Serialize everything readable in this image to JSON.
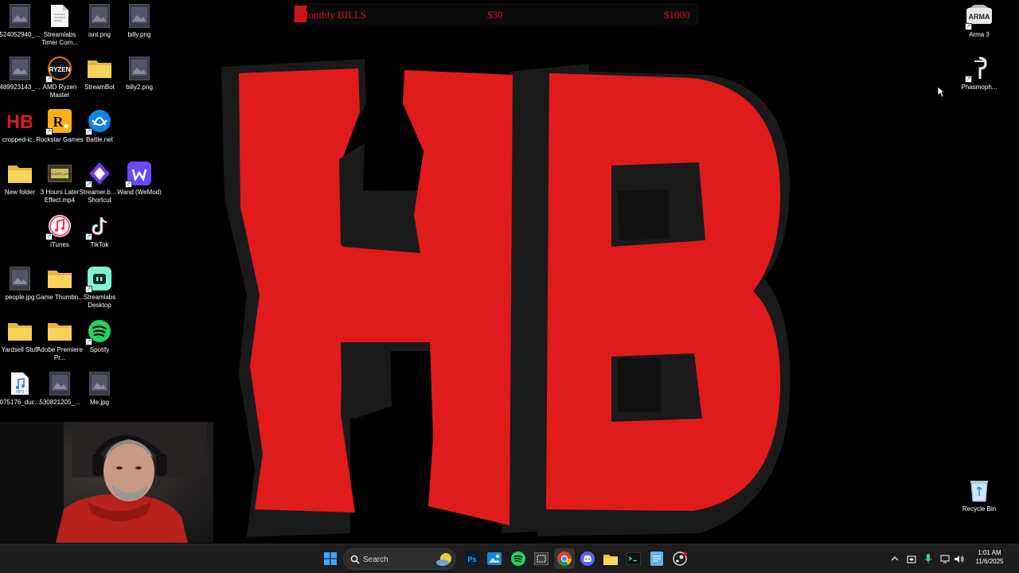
{
  "goal": {
    "title": "Monthly BILLS",
    "current": "$30",
    "target": "$1000",
    "progress_fraction": 0.03,
    "color": "#d0121b"
  },
  "brand": {
    "letters": "HB",
    "fill_color": "#e01b1b",
    "outline_color": "#1a1a1a"
  },
  "desktop_left": [
    {
      "label": "524052940_...",
      "icon": "image-icon"
    },
    {
      "label": "Streamlabs Timer Com...",
      "icon": "document-icon"
    },
    {
      "label": "isnt.png",
      "icon": "image-icon"
    },
    {
      "label": "billy.png",
      "icon": "image-icon"
    },
    {
      "label": "489923143_...",
      "icon": "image-icon"
    },
    {
      "label": "AMD Ryzen Master",
      "icon": "amd-ryzen-icon"
    },
    {
      "label": "StreamBot",
      "icon": "folder-icon"
    },
    {
      "label": "billy2.png",
      "icon": "image-icon"
    },
    {
      "label": "cropped-ic...",
      "icon": "hb-logo-icon"
    },
    {
      "label": "Rockstar Games ...",
      "icon": "rockstar-icon"
    },
    {
      "label": "Battle.net",
      "icon": "battlenet-icon"
    },
    {
      "label": "New folder",
      "icon": "folder-icon"
    },
    {
      "label": "3 Hours Later Effect.mp4",
      "icon": "video-icon"
    },
    {
      "label": "Streamer.b... - Shortcut",
      "icon": "streamerbot-icon"
    },
    {
      "label": "Wand (WeMod)",
      "icon": "wand-icon"
    },
    {
      "label": "iTunes",
      "icon": "itunes-icon"
    },
    {
      "label": "TikTok",
      "icon": "tiktok-icon"
    },
    {
      "label": "people.jpg",
      "icon": "image-icon"
    },
    {
      "label": "Game Thumbn...",
      "icon": "folder-icon"
    },
    {
      "label": "Streamlabs Desktop",
      "icon": "streamlabs-icon"
    },
    {
      "label": "Yardsell Stuff",
      "icon": "folder-icon"
    },
    {
      "label": "Adobe Premiere Pr...",
      "icon": "folder-icon"
    },
    {
      "label": "Spotify",
      "icon": "spotify-icon"
    },
    {
      "label": "075176_duc...",
      "icon": "audio-file-icon"
    },
    {
      "label": "530821205_...",
      "icon": "image-icon"
    },
    {
      "label": "Me.jpg",
      "icon": "image-icon"
    }
  ],
  "desktop_right": [
    {
      "label": "Arma 3",
      "icon": "arma3-icon"
    },
    {
      "label": "Phasmoph...",
      "icon": "phasmophobia-icon"
    },
    {
      "label": "Recycle Bin",
      "icon": "recycle-bin-icon"
    }
  ],
  "taskbar": {
    "search_placeholder": "Search",
    "apps": [
      "windows-start-icon",
      "photoshop-icon",
      "photos-icon",
      "spotify-icon",
      "snipping-tool-icon",
      "chrome-icon",
      "discord-icon",
      "file-explorer-icon",
      "terminal-icon",
      "notepad-icon",
      "steam-icon"
    ],
    "tray": [
      "chevron-up-icon",
      "nvidia-icon",
      "microphone-icon",
      "network-icon",
      "volume-icon"
    ],
    "time": "1:01 AM",
    "date": "11/6/2025"
  }
}
